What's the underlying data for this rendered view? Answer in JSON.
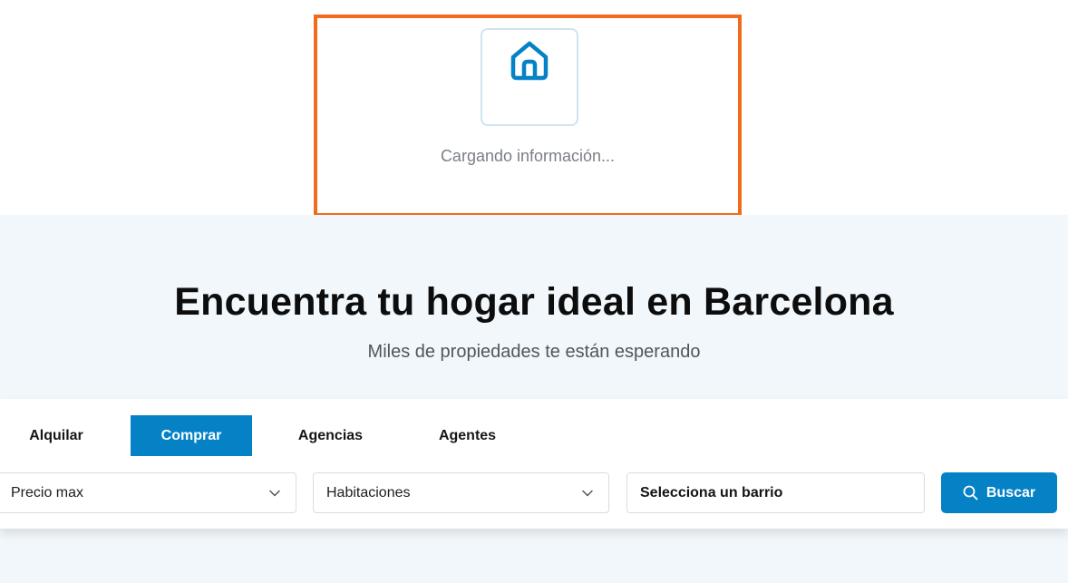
{
  "loading": {
    "icon": "home-icon",
    "text": "Cargando información...",
    "highlight_color": "#f26a1b"
  },
  "hero": {
    "title": "Encuentra tu hogar ideal en Barcelona",
    "subtitle": "Miles de propiedades te están esperando"
  },
  "search": {
    "tabs": [
      {
        "label": "Alquilar",
        "active": false
      },
      {
        "label": "Comprar",
        "active": true
      },
      {
        "label": "Agencias",
        "active": false
      },
      {
        "label": "Agentes",
        "active": false
      }
    ],
    "price_select": {
      "value": "Precio max",
      "icon": "chevron-down-icon"
    },
    "rooms_select": {
      "value": "Habitaciones",
      "icon": "chevron-down-icon"
    },
    "neighborhood": {
      "value": "Selecciona un barrio"
    },
    "button": {
      "label": "Buscar",
      "icon": "search-icon"
    }
  },
  "colors": {
    "accent": "#0582c6",
    "hero_bg": "#f1f7fa"
  }
}
